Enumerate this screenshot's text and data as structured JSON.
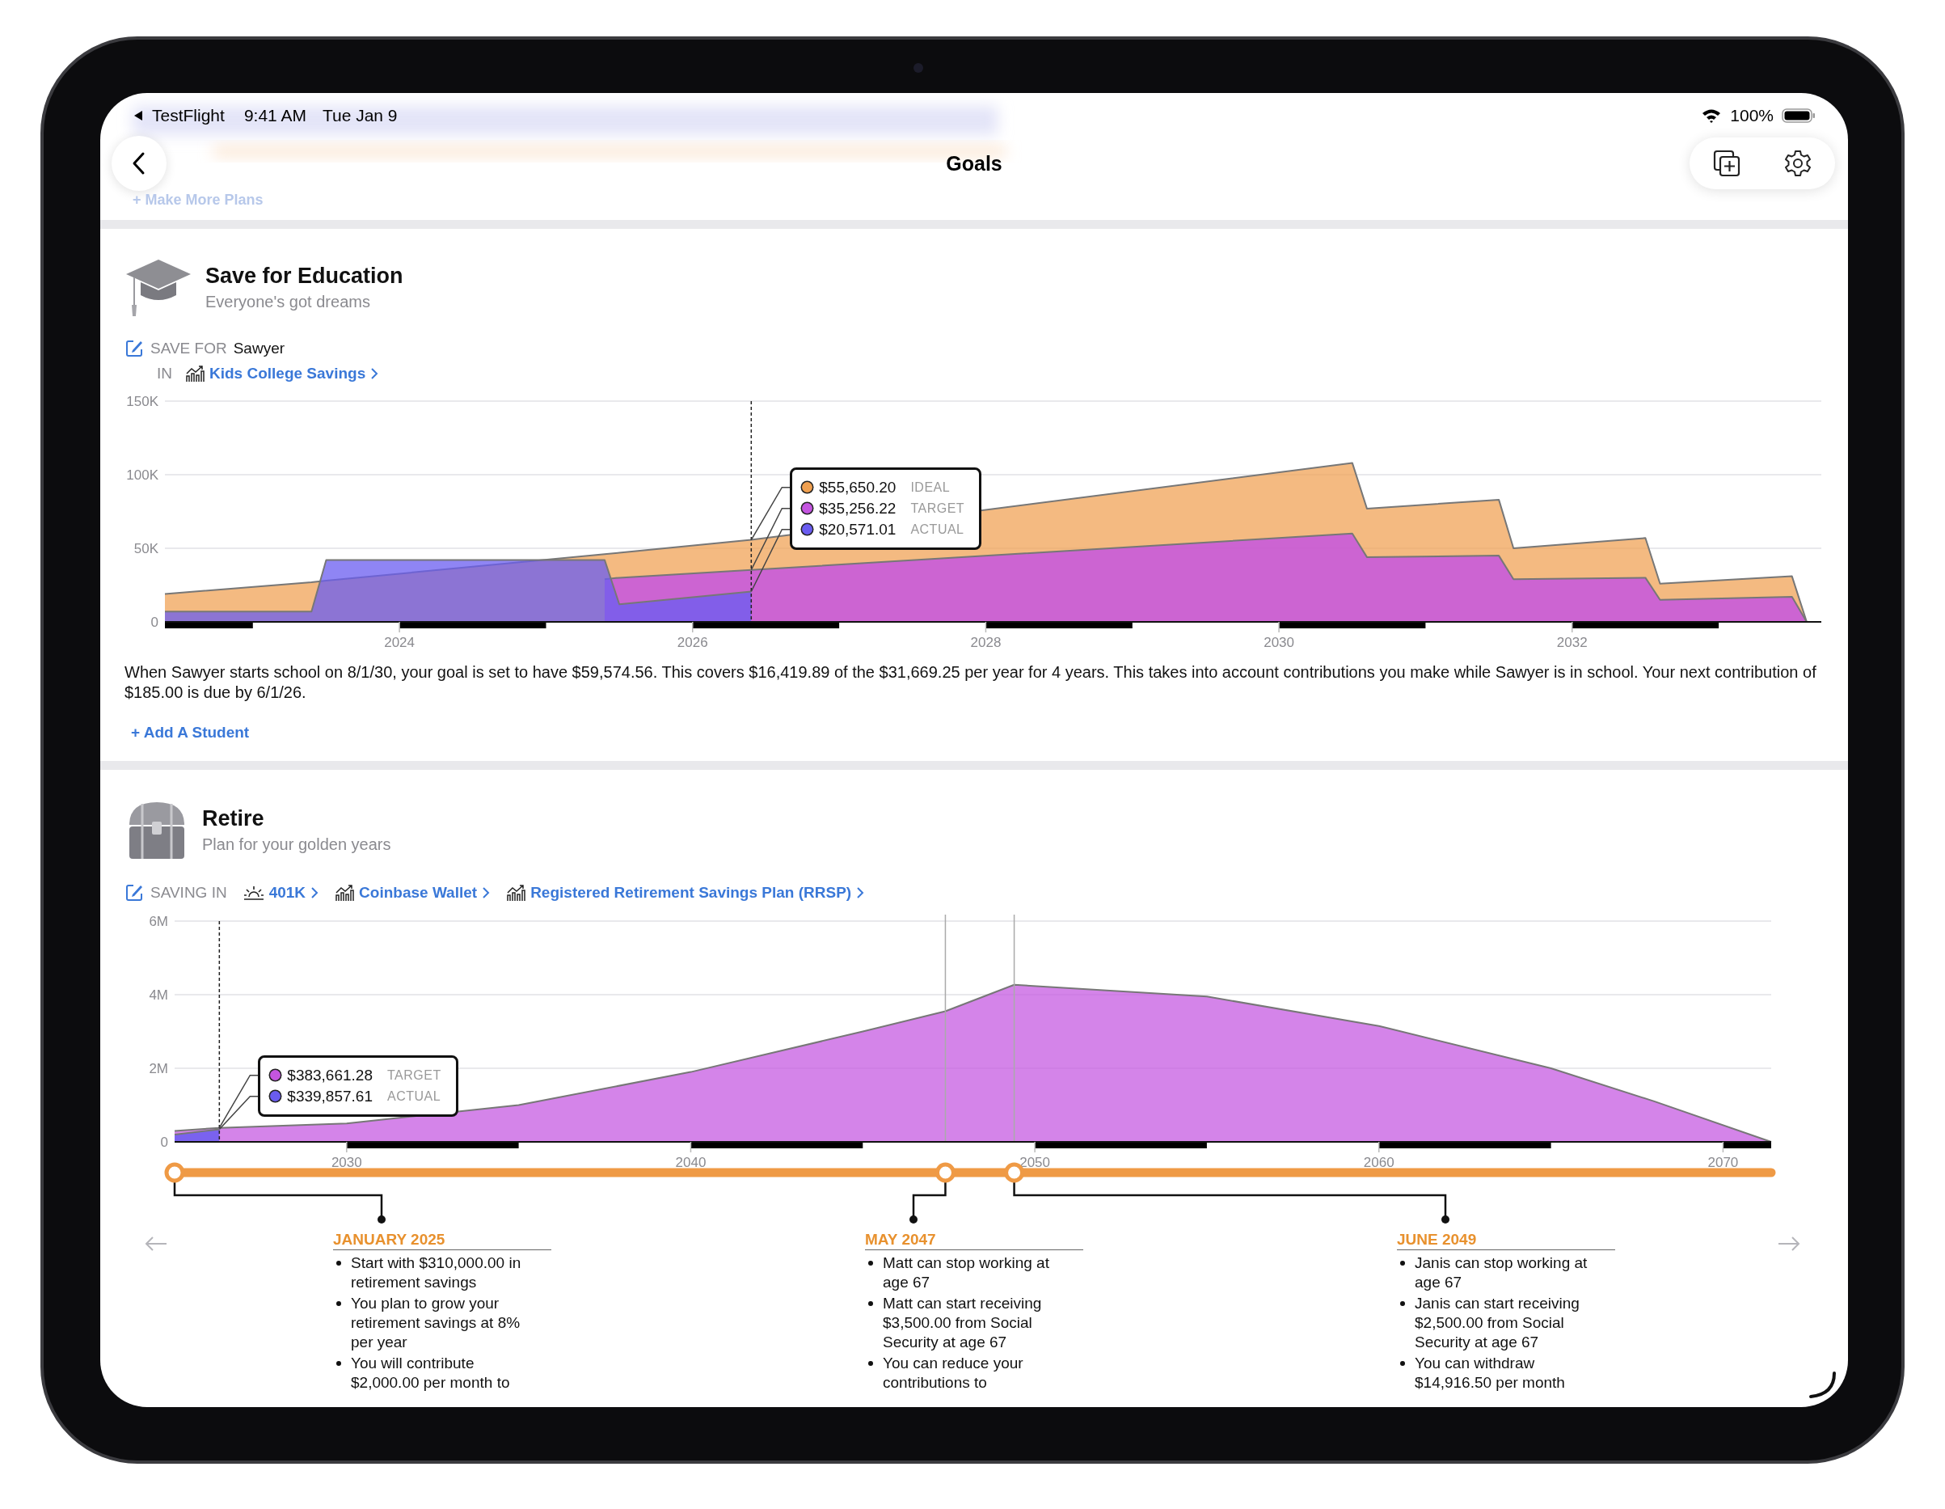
{
  "status_bar": {
    "back_app": "TestFlight",
    "time": "9:41 AM",
    "date": "Tue Jan 9",
    "battery": "100%"
  },
  "nav": {
    "title": "Goals"
  },
  "scrolled_under": {
    "link": "+ Make More Plans"
  },
  "goals": [
    {
      "kind": "education",
      "title": "Save for Education",
      "subtitle": "Everyone's got dreams",
      "for_label": "SAVE FOR",
      "for_name": "Sawyer",
      "in_label": "IN",
      "accounts": [
        {
          "name": "Kids College Savings",
          "kind": "growth"
        }
      ],
      "chart_data": {
        "type": "area",
        "x": [
          2022.4,
          2023.4,
          2023.5,
          2025.4,
          2025.5,
          2026.4,
          2030.5,
          2030.6,
          2031.5,
          2031.6,
          2032.5,
          2032.6,
          2033.5,
          2033.6
        ],
        "series": [
          {
            "name": "IDEAL",
            "color": "#f0a050",
            "values": [
              19000,
              27000,
              28000,
              46000,
              47000,
              55700,
              108000,
              77000,
              83000,
              50000,
              57000,
              26000,
              31000,
              0
            ]
          },
          {
            "name": "TARGET",
            "color": "#c455e0",
            "values": [
              null,
              null,
              null,
              29000,
              30000,
              35300,
              60000,
              44000,
              45000,
              29000,
              30000,
              15000,
              17000,
              0
            ]
          },
          {
            "name": "ACTUAL",
            "color": "#6a5cf0",
            "values": [
              7000,
              7000,
              42000,
              42000,
              12000,
              20600,
              null,
              null,
              null,
              null,
              null,
              null,
              null,
              null
            ]
          }
        ],
        "xlim": [
          2022.4,
          2033.7
        ],
        "ylim": [
          0,
          150000
        ],
        "xticks": [
          2024,
          2026,
          2028,
          2030,
          2032
        ],
        "yticks": [
          {
            "value": 0,
            "label": "0"
          },
          {
            "value": 50000,
            "label": "50K"
          },
          {
            "value": 100000,
            "label": "100K"
          },
          {
            "value": 150000,
            "label": "150K"
          }
        ]
      },
      "tooltip": [
        {
          "value": "$55,650.20"
        },
        {
          "value": "$35,256.22"
        },
        {
          "value": "$20,571.01"
        }
      ],
      "summary": "When Sawyer starts school on 8/1/30, your goal is set to have $59,574.56. This covers $16,419.89 of the $31,669.25 per year for 4 years. This takes into account contributions you make while Sawyer is in school. Your next contribution of $185.00 is due by 6/1/26.",
      "add_link": "+ Add A Student"
    },
    {
      "kind": "retirement",
      "title": "Retire",
      "subtitle": "Plan for your golden years",
      "for_label": "SAVING IN",
      "accounts": [
        {
          "name": "401K",
          "kind": "sunrise"
        },
        {
          "name": "Coinbase Wallet",
          "kind": "growth"
        },
        {
          "name": "Registered Retirement Savings Plan (RRSP)",
          "kind": "growth"
        }
      ],
      "chart_data": {
        "type": "area",
        "x": [
          2025,
          2026.3,
          2030,
          2035,
          2040,
          2045,
          2047.4,
          2049.4,
          2055,
          2060,
          2065,
          2068,
          2071.4
        ],
        "series": [
          {
            "name": "TARGET",
            "color": "#c455e0",
            "values": [
              300000,
              380000,
              500000,
              1000000,
              1900000,
              3000000,
              3550000,
              4270000,
              3950000,
              3150000,
              2000000,
              1100000,
              0
            ]
          },
          {
            "name": "ACTUAL",
            "color": "#6a5cf0",
            "values": [
              200000,
              340000,
              null,
              null,
              null,
              null,
              null,
              null,
              null,
              null,
              null,
              null,
              null
            ]
          }
        ],
        "xlim": [
          2025,
          2071.4
        ],
        "ylim": [
          0,
          6000000
        ],
        "xticks": [
          2030,
          2040,
          2050,
          2060,
          2070
        ],
        "yticks": [
          {
            "value": 0,
            "label": "0"
          },
          {
            "value": 2000000,
            "label": "2M"
          },
          {
            "value": 4000000,
            "label": "4M"
          },
          {
            "value": 6000000,
            "label": "6M"
          }
        ],
        "ref_lines": [
          {
            "axis": "x",
            "value": 2047.4
          },
          {
            "axis": "x",
            "value": 2049.4
          }
        ]
      },
      "tooltip": [
        {
          "value": "$383,661.28"
        },
        {
          "value": "$339,857.61"
        }
      ],
      "events": [
        {
          "date": "JANUARY 2025",
          "bullets": [
            "Start with $310,000.00 in retirement savings",
            "You plan to grow your retirement savings at 8% per year",
            "You will contribute $2,000.00 per month to"
          ]
        },
        {
          "date": "MAY 2047",
          "bullets": [
            "Matt can stop working at age 67",
            "Matt can start receiving $3,500.00 from Social Security at age 67",
            "You can reduce your contributions to"
          ]
        },
        {
          "date": "JUNE 2049",
          "bullets": [
            "Janis can stop working at age 67",
            "Janis can start receiving $2,500.00 from Social Security at age 67",
            "You can withdraw $14,916.50 per month"
          ]
        }
      ]
    }
  ]
}
